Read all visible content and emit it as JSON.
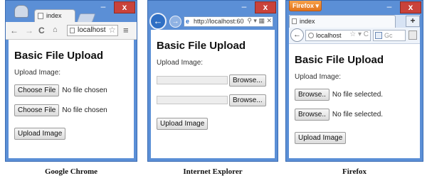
{
  "page": {
    "title": "Basic File Upload",
    "upload_label": "Upload Image:",
    "submit_label": "Upload Image"
  },
  "chrome": {
    "tab_title": "index",
    "address": "localhost",
    "choose_label": "Choose File",
    "no_file_text": "No file chosen",
    "caption": "Google Chrome"
  },
  "ie": {
    "address": "http://localhost:60",
    "browse_label": "Browse...",
    "caption": "Internet Explorer"
  },
  "firefox": {
    "menu_label": "Firefox",
    "tab_title": "index",
    "address": "localhost",
    "search_placeholder": "Gc",
    "browse_label": "Browse..",
    "no_file_text": "No file selected.",
    "caption": "Firefox"
  },
  "window_controls": {
    "close": "x",
    "minimize": "–"
  },
  "icons": {
    "back": "arrow-left-icon",
    "forward": "arrow-right-icon",
    "reload": "reload-icon",
    "home": "home-icon",
    "star": "star-icon",
    "menu": "hamburger-menu-icon",
    "page": "page-icon",
    "search": "search-icon"
  },
  "colors": {
    "window_frame": "#5b8fd6",
    "close_button": "#c9423a",
    "ie_back": "#2f6fc4",
    "firefox_menu": "#e3741c"
  }
}
